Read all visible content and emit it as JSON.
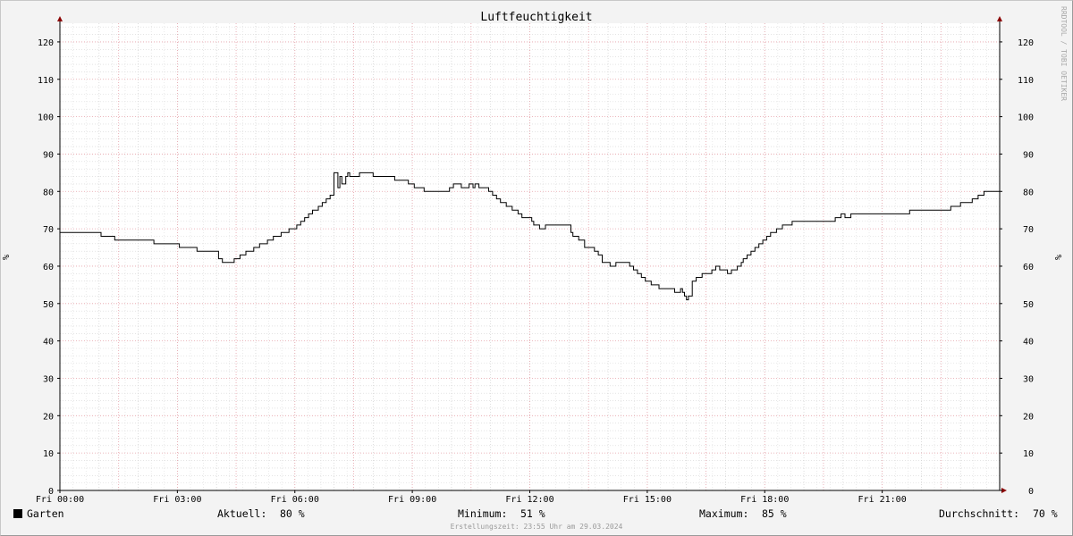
{
  "chart_data": {
    "type": "line",
    "title": "Luftfeuchtigkeit",
    "ylabel_left": "%",
    "ylabel_right": "%",
    "ylim": [
      0,
      125
    ],
    "yticks": [
      0,
      10,
      20,
      30,
      40,
      50,
      60,
      70,
      80,
      90,
      100,
      110,
      120
    ],
    "xlim_hours": [
      0,
      24
    ],
    "xticks": [
      {
        "label": "Fri 00:00",
        "hour": 0
      },
      {
        "label": "Fri 03:00",
        "hour": 3
      },
      {
        "label": "Fri 06:00",
        "hour": 6
      },
      {
        "label": "Fri 09:00",
        "hour": 9
      },
      {
        "label": "Fri 12:00",
        "hour": 12
      },
      {
        "label": "Fri 15:00",
        "hour": 15
      },
      {
        "label": "Fri 18:00",
        "hour": 18
      },
      {
        "label": "Fri 21:00",
        "hour": 21
      }
    ],
    "grid": true,
    "series": [
      {
        "name": "Garten",
        "color": "#000000",
        "step": true,
        "points": [
          [
            0.0,
            69
          ],
          [
            1.05,
            68
          ],
          [
            1.4,
            67
          ],
          [
            2.4,
            66
          ],
          [
            3.05,
            65
          ],
          [
            3.5,
            64
          ],
          [
            4.05,
            62
          ],
          [
            4.15,
            61
          ],
          [
            4.45,
            62
          ],
          [
            4.6,
            63
          ],
          [
            4.75,
            64
          ],
          [
            4.95,
            65
          ],
          [
            5.1,
            66
          ],
          [
            5.3,
            67
          ],
          [
            5.45,
            68
          ],
          [
            5.65,
            69
          ],
          [
            5.85,
            70
          ],
          [
            6.05,
            71
          ],
          [
            6.15,
            72
          ],
          [
            6.25,
            73
          ],
          [
            6.35,
            74
          ],
          [
            6.45,
            75
          ],
          [
            6.6,
            76
          ],
          [
            6.7,
            77
          ],
          [
            6.8,
            78
          ],
          [
            6.9,
            79
          ],
          [
            7.0,
            80
          ],
          [
            7.1,
            81
          ],
          [
            7.2,
            82
          ],
          [
            7.3,
            83
          ],
          [
            7.4,
            84
          ],
          [
            7.15,
            84
          ],
          [
            7.35,
            84
          ],
          [
            7.3,
            84
          ],
          [
            7.4,
            84
          ],
          [
            7.35,
            84
          ],
          [
            7.3,
            84
          ],
          [
            7.4,
            84
          ],
          [
            7.65,
            85
          ],
          [
            7.0,
            85
          ],
          [
            7.35,
            85
          ],
          [
            7.65,
            85
          ],
          [
            8.0,
            84
          ],
          [
            8.45,
            84
          ],
          [
            8.55,
            83
          ],
          [
            8.6,
            83
          ],
          [
            8.6,
            83
          ],
          [
            8.9,
            82
          ],
          [
            9.05,
            81
          ],
          [
            9.3,
            80
          ],
          [
            9.95,
            81
          ],
          [
            10.05,
            82
          ],
          [
            10.25,
            81
          ],
          [
            10.45,
            82
          ],
          [
            10.55,
            81
          ],
          [
            10.6,
            82
          ],
          [
            10.7,
            81
          ],
          [
            10.95,
            80
          ],
          [
            11.05,
            79
          ],
          [
            11.15,
            78
          ],
          [
            11.25,
            77
          ],
          [
            11.4,
            76
          ],
          [
            11.55,
            75
          ],
          [
            11.7,
            74
          ],
          [
            11.8,
            73
          ],
          [
            12.05,
            72
          ],
          [
            12.1,
            71
          ],
          [
            12.25,
            70
          ],
          [
            12.4,
            71
          ],
          [
            12.55,
            71
          ],
          [
            12.7,
            71
          ],
          [
            12.85,
            71
          ],
          [
            12.95,
            71
          ],
          [
            13.05,
            69
          ],
          [
            13.1,
            68
          ],
          [
            13.25,
            67
          ],
          [
            13.4,
            65
          ],
          [
            13.55,
            65
          ],
          [
            13.65,
            64
          ],
          [
            13.75,
            63
          ],
          [
            13.85,
            61
          ],
          [
            14.0,
            61
          ],
          [
            14.05,
            60
          ],
          [
            14.2,
            61
          ],
          [
            14.45,
            61
          ],
          [
            14.55,
            60
          ],
          [
            14.65,
            59
          ],
          [
            14.75,
            58
          ],
          [
            14.85,
            57
          ],
          [
            14.95,
            56
          ],
          [
            15.1,
            55
          ],
          [
            15.3,
            54
          ],
          [
            15.7,
            53
          ],
          [
            15.85,
            54
          ],
          [
            15.9,
            53
          ],
          [
            15.95,
            52
          ],
          [
            16.0,
            51
          ],
          [
            16.05,
            52
          ],
          [
            16.15,
            56
          ],
          [
            16.25,
            57
          ],
          [
            16.4,
            58
          ],
          [
            16.65,
            59
          ],
          [
            16.75,
            60
          ],
          [
            16.85,
            59
          ],
          [
            17.05,
            58
          ],
          [
            17.15,
            59
          ],
          [
            17.3,
            60
          ],
          [
            17.4,
            61
          ],
          [
            17.45,
            62
          ],
          [
            17.55,
            63
          ],
          [
            17.65,
            64
          ],
          [
            17.75,
            65
          ],
          [
            17.85,
            66
          ],
          [
            17.95,
            67
          ],
          [
            18.05,
            68
          ],
          [
            18.15,
            69
          ],
          [
            18.3,
            70
          ],
          [
            18.45,
            71
          ],
          [
            18.7,
            72
          ],
          [
            19.1,
            72
          ],
          [
            19.8,
            73
          ],
          [
            19.95,
            74
          ],
          [
            20.05,
            73
          ],
          [
            20.2,
            74
          ],
          [
            20.7,
            74
          ],
          [
            21.25,
            74
          ],
          [
            21.7,
            75
          ],
          [
            22.25,
            75
          ],
          [
            22.75,
            76
          ],
          [
            23.0,
            77
          ],
          [
            23.3,
            78
          ],
          [
            23.45,
            79
          ],
          [
            23.6,
            80
          ],
          [
            24.0,
            80
          ]
        ]
      }
    ]
  },
  "legend": {
    "series_name": "Garten",
    "aktuell_label": "Aktuell:",
    "aktuell_value": "80 %",
    "minimum_label": "Minimum:",
    "minimum_value": "51 %",
    "maximum_label": "Maximum:",
    "maximum_value": "85 %",
    "durchschnitt_label": "Durchschnitt:",
    "durchschnitt_value": "70 %"
  },
  "footer": {
    "timestamp": "Erstellungszeit: 23:55 Uhr am 29.03.2024"
  },
  "watermark": "RRDTOOL / TOBI OETIKER"
}
